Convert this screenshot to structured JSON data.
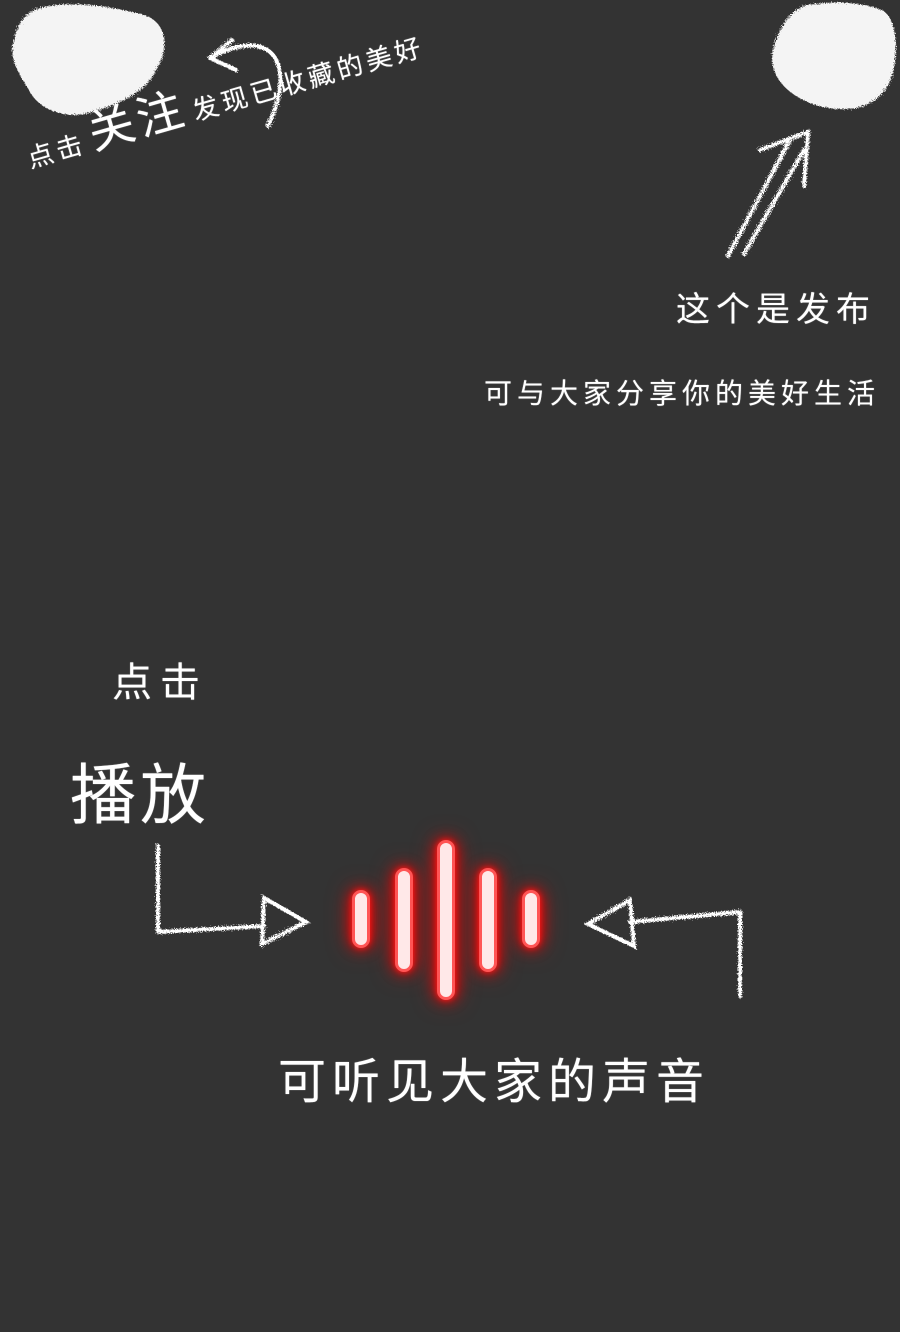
{
  "follow_hint": {
    "prefix": "点击",
    "emphasis": "关注",
    "suffix": "发现已收藏的美好"
  },
  "publish_hint": {
    "title": "这个是发布",
    "description": "可与大家分享你的美好生活"
  },
  "play_hint": {
    "prefix": "点击",
    "action": "播放",
    "result": "可听见大家的声音"
  },
  "theme": {
    "background": "#333333",
    "chalk": "#ffffff",
    "accent": "#ff1a1a"
  },
  "icons": {
    "follow_button": "chalk-smudge",
    "publish_button": "chalk-smudge",
    "play_button": "sound-wave-icon",
    "arrows": [
      "curved-arrow-up",
      "double-arrow-up-right",
      "elbow-arrow-right",
      "elbow-arrow-left"
    ]
  }
}
